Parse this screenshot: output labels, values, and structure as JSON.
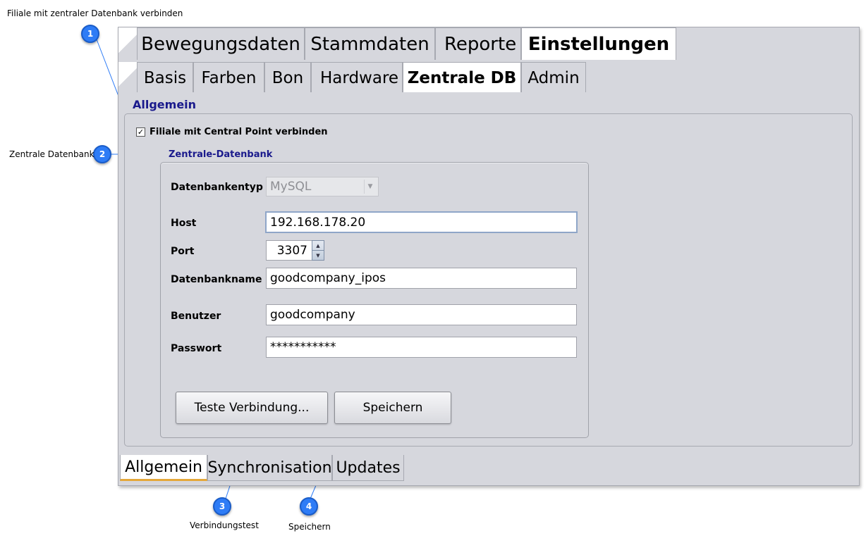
{
  "caption": "Filiale mit zentraler Datenbank verbinden",
  "main_tabs": [
    "Bewegungsdaten",
    "Stammdaten",
    "Reporte",
    "Einstellungen"
  ],
  "main_tab_active": "Einstellungen",
  "sub_tabs": [
    "Basis",
    "Farben",
    "Bon",
    "Hardware",
    "Zentrale DB",
    "Admin"
  ],
  "sub_tab_active": "Zentrale DB",
  "section_title": "Allgemein",
  "checkbox": {
    "label": "Filiale mit Central Point verbinden",
    "checked": true,
    "mark": "✓"
  },
  "subgroup_title": "Zentrale-Datenbank",
  "form": {
    "dbtype": {
      "label": "Datenbankentyp",
      "value": "MySQL"
    },
    "host": {
      "label": "Host",
      "value": "192.168.178.20"
    },
    "port": {
      "label": "Port",
      "value": "3307"
    },
    "dbname": {
      "label": "Datenbankname",
      "value": "goodcompany_ipos"
    },
    "user": {
      "label": "Benutzer",
      "value": "goodcompany"
    },
    "password": {
      "label": "Passwort",
      "value": "***********"
    }
  },
  "buttons": {
    "test": "Teste Verbindung...",
    "save": "Speichern"
  },
  "bottom_tabs": [
    "Allgemein",
    "Synchronisation",
    "Updates"
  ],
  "bottom_tab_active": "Allgemein",
  "callouts": [
    {
      "number": "1",
      "label": ""
    },
    {
      "number": "2",
      "label": "Zentrale Datenbank"
    },
    {
      "number": "3",
      "label": "Verbindungstest"
    },
    {
      "number": "4",
      "label": "Speichern"
    }
  ],
  "colors": {
    "badge": "#2e7cf6",
    "section_title": "#1a1a8c",
    "active_underline": "#e4a83a",
    "window_bg": "#d6d7dd"
  }
}
